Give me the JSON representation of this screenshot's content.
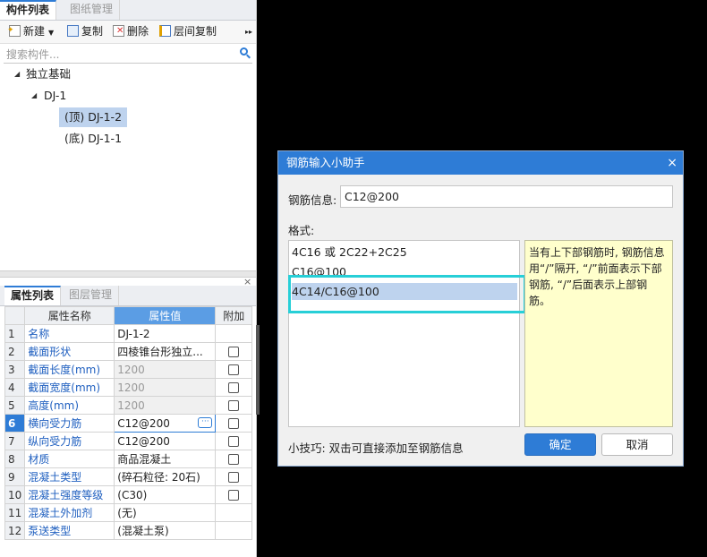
{
  "component_panel": {
    "tabs": [
      "构件列表",
      "图纸管理"
    ],
    "toolbar": {
      "new_label": "新建",
      "copy_label": "复制",
      "delete_label": "删除",
      "floor_copy_label": "层间复制",
      "more_symbol": "▸▸"
    },
    "search_placeholder": "搜索构件...",
    "tree": {
      "root": "独立基础",
      "child": "DJ-1",
      "leaves": [
        "(顶) DJ-1-2",
        "(底) DJ-1-1"
      ]
    }
  },
  "property_panel": {
    "close_symbol": "×",
    "tabs": [
      "属性列表",
      "图层管理"
    ],
    "headers": [
      "属性名称",
      "属性值",
      "附加"
    ],
    "rows": [
      {
        "num": "1",
        "name": "名称",
        "value": "DJ-1-2",
        "checkbox": false
      },
      {
        "num": "2",
        "name": "截面形状",
        "value": "四棱锥台形独立...",
        "checkbox": true
      },
      {
        "num": "3",
        "name": "截面长度(mm)",
        "value": "1200",
        "checkbox": true
      },
      {
        "num": "4",
        "name": "截面宽度(mm)",
        "value": "1200",
        "checkbox": true
      },
      {
        "num": "5",
        "name": "高度(mm)",
        "value": "1200",
        "checkbox": true
      },
      {
        "num": "6",
        "name": "横向受力筋",
        "value": "C12@200",
        "checkbox": true
      },
      {
        "num": "7",
        "name": "纵向受力筋",
        "value": "C12@200",
        "checkbox": true
      },
      {
        "num": "8",
        "name": "材质",
        "value": "商品混凝土",
        "checkbox": true
      },
      {
        "num": "9",
        "name": "混凝土类型",
        "value": "(碎石粒径: 20石)",
        "checkbox": true
      },
      {
        "num": "10",
        "name": "混凝土强度等级",
        "value": "(C30)",
        "checkbox": true
      },
      {
        "num": "11",
        "name": "混凝土外加剂",
        "value": "(无)",
        "checkbox": false
      },
      {
        "num": "12",
        "name": "泵送类型",
        "value": "(混凝土泵)",
        "checkbox": false
      }
    ],
    "edit_button_symbol": "···"
  },
  "dialog": {
    "title": "钢筋输入小助手",
    "close_symbol": "×",
    "rebar_info_label": "钢筋信息:",
    "rebar_info_value": "C12@200",
    "format_label": "格式:",
    "format_items": [
      "4C16 或 2C22+2C25",
      "C16@100",
      "4C14/C16@100"
    ],
    "selected_index": 2,
    "hint_text": "当有上下部钢筋时, 钢筋信息用“/”隔开, “/”前面表示下部钢筋, “/”后面表示上部钢筋。",
    "tip": "小技巧: 双击可直接添加至钢筋信息",
    "ok_label": "确定",
    "cancel_label": "取消"
  },
  "colors": {
    "accent": "#2e7cd6",
    "highlight": "#27cfd7",
    "selection": "#bed3ee",
    "hint_bg": "#ffffcc"
  }
}
